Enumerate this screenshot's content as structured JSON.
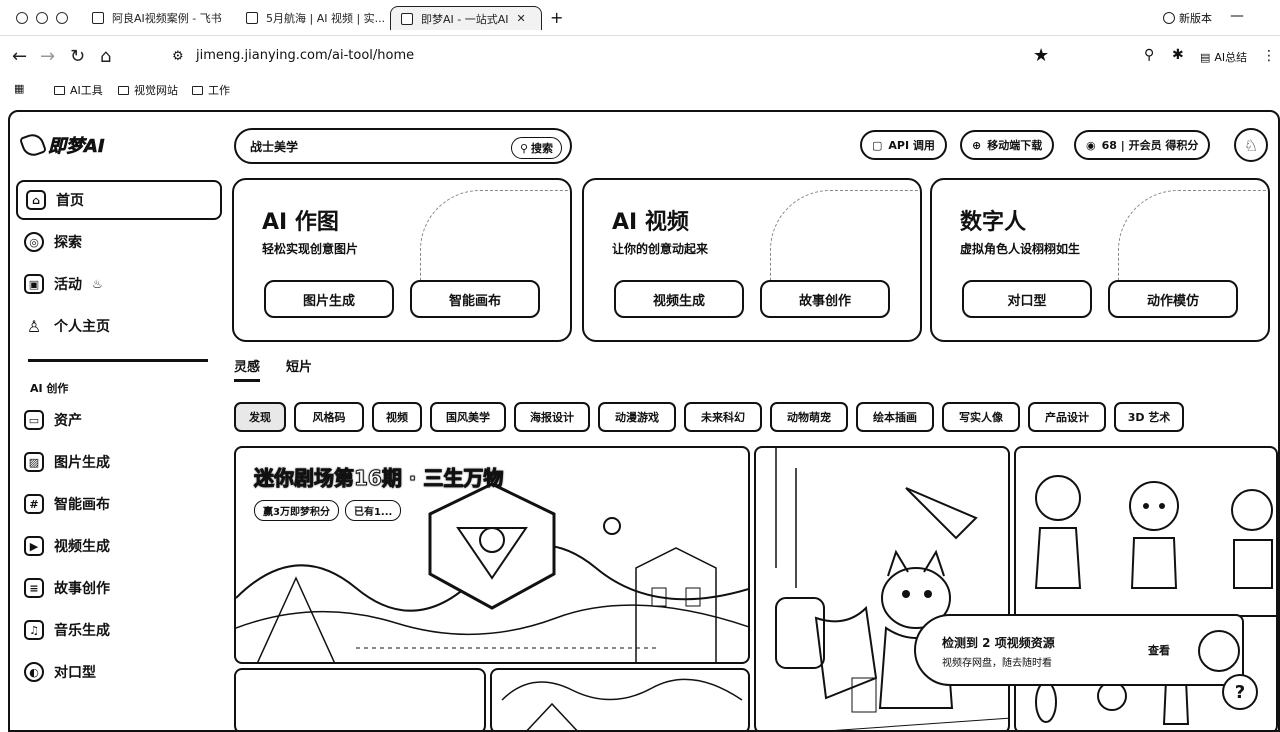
{
  "browser": {
    "tabs": [
      {
        "label": "阿良AI视频案例 - 飞书"
      },
      {
        "label": "5月航海 | AI 视频 | 实..."
      },
      {
        "label": "即梦AI - 一站式AI"
      }
    ],
    "new_version": "新版本",
    "url": "jimeng.jianying.com/ai-tool/home",
    "ai_summary": "AI总结",
    "bookmarks": [
      "AI工具",
      "视觉网站",
      "工作"
    ]
  },
  "sidebar": {
    "logo": "即梦AI",
    "items": [
      {
        "label": "首页",
        "icon": "home-icon"
      },
      {
        "label": "探索",
        "icon": "compass-icon"
      },
      {
        "label": "活动",
        "icon": "gift-icon"
      },
      {
        "label": "个人主页",
        "icon": "user-icon"
      }
    ],
    "section_label": "AI 创作",
    "tools": [
      {
        "label": "资产",
        "icon": "folder-icon"
      },
      {
        "label": "图片生成",
        "icon": "image-icon"
      },
      {
        "label": "智能画布",
        "icon": "canvas-icon"
      },
      {
        "label": "视频生成",
        "icon": "video-icon"
      },
      {
        "label": "故事创作",
        "icon": "story-icon"
      },
      {
        "label": "音乐生成",
        "icon": "music-icon"
      },
      {
        "label": "对口型",
        "icon": "lipsync-icon"
      }
    ]
  },
  "header": {
    "search_placeholder": "战士美学",
    "search_button": "搜索",
    "api_button": "API 调用",
    "mobile_button": "移动端下载",
    "credits_button": "68 | 开会员 得积分"
  },
  "features": [
    {
      "title": "AI 作图",
      "subtitle": "轻松实现创意图片",
      "buttons": [
        "图片生成",
        "智能画布"
      ]
    },
    {
      "title": "AI 视频",
      "subtitle": "让你的创意动起来",
      "buttons": [
        "视频生成",
        "故事创作"
      ]
    },
    {
      "title": "数字人",
      "subtitle": "虚拟角色人设栩栩如生",
      "buttons": [
        "对口型",
        "动作模仿"
      ]
    }
  ],
  "content_tabs": [
    "灵感",
    "短片"
  ],
  "chips": [
    "发现",
    "风格码",
    "视频",
    "国风美学",
    "海报设计",
    "动漫游戏",
    "未来科幻",
    "动物萌宠",
    "绘本插画",
    "写实人像",
    "产品设计",
    "3D 艺术"
  ],
  "banner": {
    "title": "迷你剧场第16期 · 三生万物",
    "meta": [
      "赢3万即梦积分",
      "已有1..."
    ]
  },
  "toast": {
    "title": "检测到 2 项视频资源",
    "subtitle": "视频存网盘，随去随时看",
    "action": "查看"
  },
  "help": "?"
}
